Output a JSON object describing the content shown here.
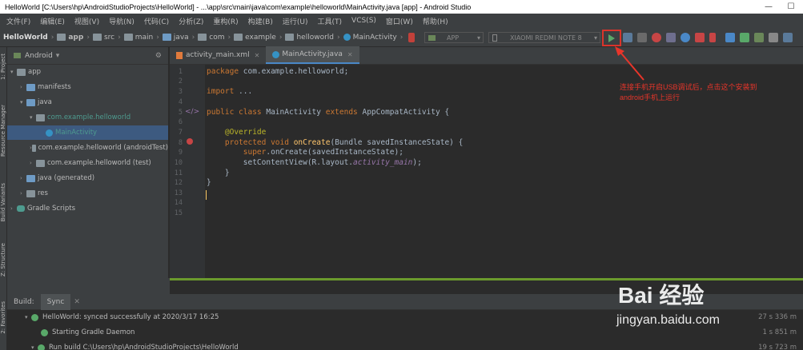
{
  "window": {
    "title": "HelloWorld [C:\\Users\\hp\\AndroidStudioProjects\\HelloWorld] - ...\\app\\src\\main\\java\\com\\example\\helloworld\\MainActivity.java [app] - Android Studio",
    "minimize": "—",
    "maximize": "☐"
  },
  "menu": [
    "文件(F)",
    "编辑(E)",
    "视图(V)",
    "导航(N)",
    "代码(C)",
    "分析(Z)",
    "重构(R)",
    "构建(B)",
    "运行(U)",
    "工具(T)",
    "VCS(S)",
    "窗口(W)",
    "帮助(H)"
  ],
  "breadcrumb": [
    "HelloWorld",
    "app",
    "src",
    "main",
    "java",
    "com",
    "example",
    "helloworld",
    "MainActivity"
  ],
  "toolbar": {
    "config": "APP",
    "device": "XIAOMI REDMI NOTE 8"
  },
  "sidebar_labels": {
    "project": "1: Project",
    "resource": "Resource Manager",
    "build_variants": "Build Variants",
    "structure": "Z: Structure",
    "favorites": "2: Favorites"
  },
  "project": {
    "view": "Android",
    "tree": [
      {
        "label": "app",
        "depth": 0,
        "icon": "folder"
      },
      {
        "label": "manifests",
        "depth": 1,
        "icon": "folder"
      },
      {
        "label": "java",
        "depth": 1,
        "icon": "folder"
      },
      {
        "label": "com.example.helloworld",
        "depth": 2,
        "icon": "package"
      },
      {
        "label": "MainActivity",
        "depth": 3,
        "icon": "class",
        "selected": true
      },
      {
        "label": "com.example.helloworld (androidTest)",
        "depth": 2,
        "icon": "package"
      },
      {
        "label": "com.example.helloworld (test)",
        "depth": 2,
        "icon": "package"
      },
      {
        "label": "java (generated)",
        "depth": 1,
        "icon": "folder"
      },
      {
        "label": "res",
        "depth": 1,
        "icon": "folder"
      },
      {
        "label": "Gradle Scripts",
        "depth": 0,
        "icon": "gradle"
      }
    ]
  },
  "editor": {
    "tabs": [
      {
        "label": "activity_main.xml",
        "active": false
      },
      {
        "label": "MainActivity.java",
        "active": true
      }
    ],
    "line_numbers": [
      "1",
      "2",
      "3",
      "4",
      "5",
      "6",
      "7",
      "8",
      "9",
      "10",
      "11",
      "12",
      "13",
      "14",
      "15"
    ]
  },
  "annotation": "连接手机开启USB调试后，点击这个安装到android手机上运行",
  "build": {
    "tabs": [
      "Build:",
      "Sync"
    ],
    "rows": [
      {
        "text": "HelloWorld: synced successfully at 2020/3/17 16:25",
        "time": "27 s 336 m"
      },
      {
        "text": "Starting Gradle Daemon",
        "time": "1 s 851 m"
      },
      {
        "text": "Run build C:\\Users\\hp\\AndroidStudioProjects\\HelloWorld",
        "time": "19 s 723 m"
      }
    ]
  },
  "watermark": {
    "brand": "Bai 经验",
    "url": "jingyan.baidu.com"
  },
  "colors": {
    "run_highlight": "#d9342b",
    "annotation": "#e8352a",
    "keyword": "#cc7832"
  }
}
